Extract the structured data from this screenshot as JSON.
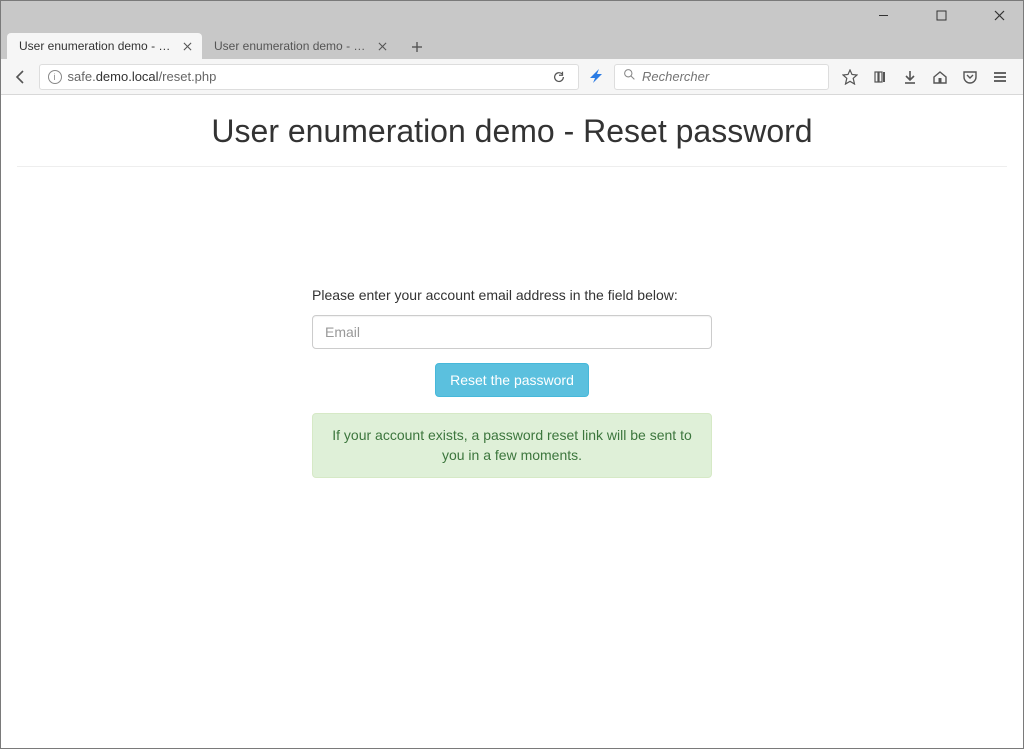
{
  "window": {
    "tabs": [
      {
        "title": "User enumeration demo - Reset",
        "active": true
      },
      {
        "title": "User enumeration demo - Reset",
        "active": false
      }
    ]
  },
  "toolbar": {
    "url_prefix": "safe.",
    "url_host": "demo.local",
    "url_path": "/reset.php",
    "search_placeholder": "Rechercher"
  },
  "page": {
    "title": "User enumeration demo - Reset password",
    "prompt": "Please enter your account email address in the field below:",
    "email_placeholder": "Email",
    "reset_button": "Reset the password",
    "success_message": "If your account exists, a password reset link will be sent to you in a few moments."
  },
  "colors": {
    "button_bg": "#5bc0de",
    "alert_bg": "#dff0d8",
    "alert_text": "#3c763d"
  }
}
